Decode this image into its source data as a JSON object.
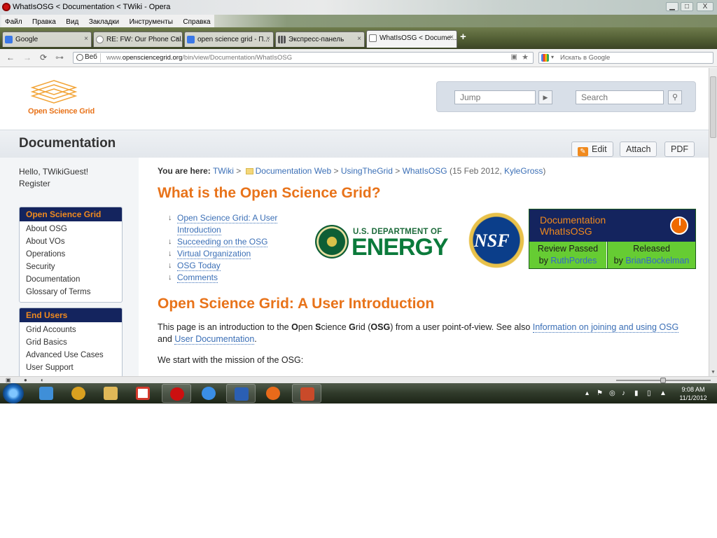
{
  "window": {
    "title": "WhatIsOSG < Documentation < TWiki - Opera",
    "minimize": "▁",
    "maximize": "□",
    "close": "X"
  },
  "menu": [
    "Файл",
    "Правка",
    "Вид",
    "Закладки",
    "Инструменты",
    "Справка"
  ],
  "tabs": [
    {
      "label": "Google",
      "icon": "google-icon",
      "color": "#3b78e7"
    },
    {
      "label": "RE: FW: Our Phone Cal...",
      "icon": "reload-icon",
      "color": "#999999"
    },
    {
      "label": "open science grid - П...",
      "icon": "google-icon",
      "color": "#3b78e7"
    },
    {
      "label": "Экспресс-панель",
      "icon": "speed-dial-icon",
      "color": "#666666"
    },
    {
      "label": "WhatIsOSG < Docume...",
      "icon": "page-icon",
      "color": "#777777",
      "active": true
    }
  ],
  "new_tab": "+",
  "address": {
    "web_badge": "Веб",
    "url_prefix": "www.",
    "url_host": "opensciencegrid.org",
    "url_path": "/bin/view/Documentation/WhatIsOSG",
    "search_placeholder": "Искать в Google"
  },
  "header": {
    "logo_text": "Open Science Grid",
    "jump_placeholder": "Jump",
    "search_placeholder": "Search"
  },
  "docbar": {
    "web_title": "Documentation",
    "edit": "Edit",
    "attach": "Attach",
    "pdf": "PDF"
  },
  "leftbar": {
    "hello": "Hello, TWikiGuest!",
    "register": "Register",
    "boxes": [
      {
        "title": "Open Science Grid",
        "items": [
          "About OSG",
          "About VOs",
          "Operations",
          "Security",
          "Documentation",
          "Glossary of Terms"
        ]
      },
      {
        "title": "End Users",
        "items": [
          "Grid Accounts",
          "Grid Basics",
          "Advanced Use Cases",
          "User Support"
        ]
      }
    ]
  },
  "breadcrumb": {
    "label": "You are here:",
    "twiki": "TWiki",
    "web": "Documentation Web",
    "parent": "UsingTheGrid",
    "topic": "WhatIsOSG",
    "date_open": "(15 Feb 2012,",
    "author": "KyleGross",
    "date_close": ")",
    "sep": ">"
  },
  "main": {
    "title": "What is the Open Science Grid?",
    "toc": [
      {
        "line1": "Open Science Grid: A User",
        "line2": "Introduction"
      },
      {
        "line1": "Succeeding on the OSG"
      },
      {
        "line1": "Virtual Organization"
      },
      {
        "line1": "OSG Today"
      },
      {
        "line1": "Comments"
      }
    ],
    "doe_line1": "U.S. DEPARTMENT OF",
    "doe_line2": "ENERGY",
    "nsf": "NSF",
    "status": {
      "line1": "Documentation",
      "line2": "WhatIsOSG",
      "review": "Review Passed",
      "review_by": "by",
      "reviewer": "RuthPordes",
      "released": "Released",
      "released_by": "by",
      "releaser": "BrianBockelman"
    },
    "section_title": "Open Science Grid: A User Introduction",
    "intro": {
      "p1": "This page is an introduction to the ",
      "o": "O",
      "p2": "pen ",
      "s": "S",
      "p3": "cience ",
      "g": "G",
      "p4": "rid (",
      "osg": "OSG",
      "p5": ") from a user point-of-view. See also ",
      "link1": "Information on joining and using OSG",
      "p6": " and ",
      "link2": "User Documentation",
      "p7": "."
    },
    "mission": "We start with the mission of the OSG:"
  },
  "taskbar": {
    "apps": [
      {
        "name": "dropbox-icon",
        "color": "#3f8fd8"
      },
      {
        "name": "chrome-like-icon",
        "color": "#d9a020"
      },
      {
        "name": "file-explorer-icon",
        "color": "#e0b858"
      },
      {
        "name": "gmail-icon",
        "color": "#d33a2c"
      },
      {
        "name": "opera-icon",
        "color": "#cc1010",
        "running": true
      },
      {
        "name": "internet-explorer-icon",
        "color": "#3a8ee6"
      },
      {
        "name": "word-icon",
        "color": "#2b5fb3",
        "running": true
      },
      {
        "name": "firefox-icon",
        "color": "#e86a1a"
      },
      {
        "name": "presentation-icon",
        "color": "#c94a2a",
        "running": true
      }
    ],
    "time": "9:08 AM",
    "date": "11/1/2012"
  }
}
